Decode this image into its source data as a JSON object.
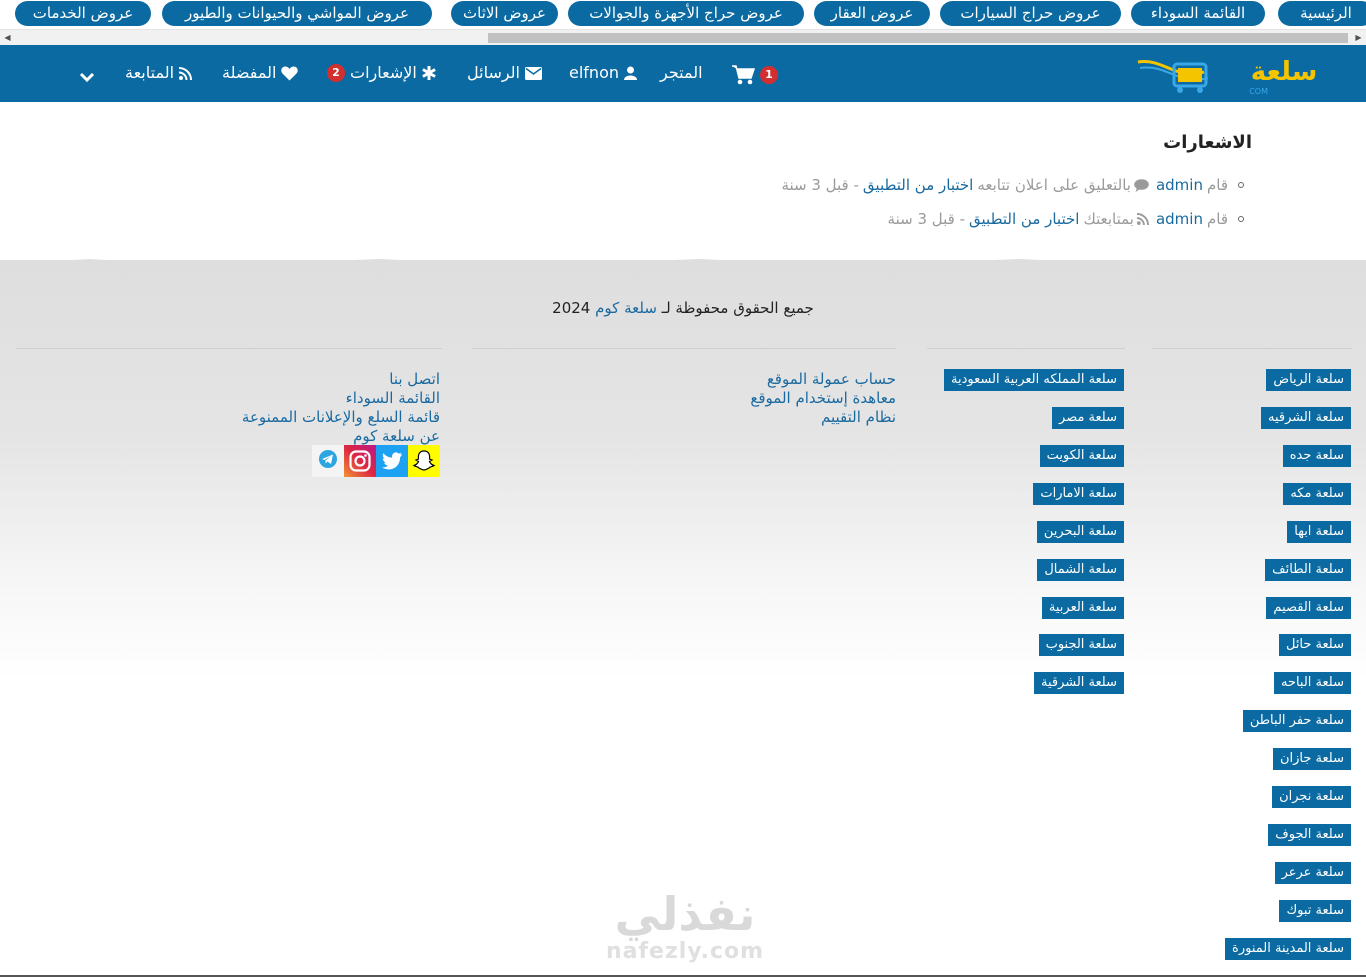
{
  "top_categories": [
    "الرئيسية",
    "القائمة السوداء",
    "عروض حراج السيارات",
    "عروض العقار",
    "عروض حراج الأجهزة والجوالات",
    "عروض الاثاث",
    "عروض المواشي والحيوانات والطيور",
    "عروض الخدمات"
  ],
  "scrollbar": {
    "left_arrow": "◀",
    "right_arrow": "▶"
  },
  "header": {
    "logo_text": "سلعة",
    "nav": {
      "cart_count": "1",
      "store": "المتجر",
      "user": "elfnon",
      "messages": "الرسائل",
      "notifications": "الإشعارات",
      "notifications_count": "2",
      "favorites": "المفضلة",
      "following": "المتابعة"
    }
  },
  "notifications": {
    "title": "الاشعارات",
    "items": [
      {
        "prefix": "قام",
        "user": "admin",
        "action": "بالتعليق على اعلان تتابعه",
        "link": "اختبار من التطبيق",
        "time": "- قبل 3 سنة"
      },
      {
        "prefix": "قام",
        "user": "admin",
        "action": "بمتابعتك",
        "link": "اختبار من التطبيق",
        "time": "- قبل 3 سنة"
      }
    ]
  },
  "footer": {
    "copyright_prefix": "جميع الحقوق محفوظة لـ",
    "copyright_brand": "سلعة كوم",
    "copyright_year": "2024",
    "cities_col1": [
      "سلعة الرياض",
      "سلعة الشرقيه",
      "سلعة جده",
      "سلعة مكه",
      "سلعة ابها",
      "سلعة الطائف",
      "سلعة القصيم",
      "سلعة حائل",
      "سلعة الباحه",
      "سلعة حفر الباطن",
      "سلعة جازان",
      "سلعة نجران",
      "سلعة الجوف",
      "سلعة عرعر",
      "سلعة تبوك",
      "سلعة المدينة المنورة"
    ],
    "cities_col2": [
      "سلعة المملكه العربية السعودية",
      "سلعة مصر",
      "سلعة الكويت",
      "سلعة الامارات",
      "سلعة البحرين",
      "سلعة الشمال",
      "سلعة العربية",
      "سلعة الجنوب",
      "سلعة الشرقية"
    ],
    "links_col3": [
      "حساب عمولة الموقع",
      "معاهدة إستخدام الموقع",
      "نظام التقييم"
    ],
    "links_col4": [
      "اتصل بنا",
      "القائمة السوداء",
      "قائمة السلع والإعلانات الممنوعة",
      "عن سلعة كوم"
    ],
    "social": [
      "snapchat-icon",
      "twitter-icon",
      "instagram-icon",
      "telegram-icon"
    ]
  },
  "watermark": {
    "arabic": "نفذلي",
    "latin": "nafezly.com"
  },
  "colors": {
    "primary": "#0a6aa1",
    "link": "#1a6aa0",
    "badge": "#d32f2f"
  }
}
